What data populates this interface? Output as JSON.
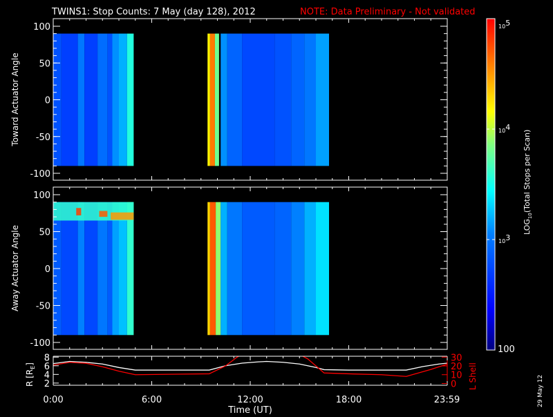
{
  "chart_data": [
    {
      "type": "heatmap",
      "title": "TWINS1: Stop Counts:  7 May (day 128), 2012",
      "note": "NOTE: Data Preliminary - Not validated",
      "ylabel": "Toward Actuator Angle",
      "ylim": [
        -100,
        100
      ],
      "yticks": [
        "100",
        "50",
        "0",
        "-50",
        "-100"
      ],
      "ytick_values": [
        100,
        50,
        0,
        -50,
        -100
      ],
      "xlim_hours": [
        0,
        24
      ],
      "angle_range": [
        -90,
        90
      ],
      "stripes": [
        [
          0,
          0.5,
          2.8
        ],
        [
          0.5,
          1.5,
          2.7
        ],
        [
          1.5,
          1.9,
          3.0
        ],
        [
          1.9,
          2.7,
          2.7
        ],
        [
          2.7,
          3.3,
          2.95
        ],
        [
          3.3,
          3.6,
          2.8
        ],
        [
          3.6,
          4.0,
          3.1
        ],
        [
          4.0,
          4.5,
          3.2
        ],
        [
          4.5,
          4.9,
          3.55
        ],
        [
          9.4,
          9.55,
          4.2
        ],
        [
          9.55,
          9.85,
          4.6
        ],
        [
          9.85,
          10.1,
          3.8
        ],
        [
          10.2,
          10.6,
          3.1
        ],
        [
          10.6,
          11.5,
          2.9
        ],
        [
          11.5,
          13.5,
          2.75
        ],
        [
          13.5,
          14.5,
          2.8
        ],
        [
          14.5,
          15.3,
          2.9
        ],
        [
          15.3,
          16.0,
          3.0
        ],
        [
          16.0,
          16.8,
          3.15
        ]
      ]
    },
    {
      "type": "heatmap",
      "ylabel": "Away Actuator Angle",
      "ylim": [
        -100,
        100
      ],
      "yticks": [
        "100",
        "50",
        "0",
        "-50",
        "-100"
      ],
      "ytick_values": [
        100,
        50,
        0,
        -50,
        -100
      ],
      "xlim_hours": [
        0,
        24
      ],
      "angle_range": [
        -90,
        90
      ],
      "stripes": [
        [
          0,
          0.5,
          2.85
        ],
        [
          0.5,
          1.5,
          2.75
        ],
        [
          1.5,
          1.9,
          3.05
        ],
        [
          1.9,
          2.7,
          2.75
        ],
        [
          2.7,
          3.3,
          3.0
        ],
        [
          3.3,
          3.6,
          2.85
        ],
        [
          3.6,
          4.0,
          3.15
        ],
        [
          4.0,
          4.5,
          3.25
        ],
        [
          4.5,
          4.9,
          3.6
        ],
        [
          9.4,
          9.55,
          4.3
        ],
        [
          9.55,
          9.9,
          4.7
        ],
        [
          9.9,
          10.2,
          3.9
        ],
        [
          10.2,
          10.6,
          3.2
        ],
        [
          10.6,
          11.5,
          3.0
        ],
        [
          11.5,
          13.5,
          2.85
        ],
        [
          13.5,
          14.5,
          2.9
        ],
        [
          14.5,
          15.3,
          3.05
        ],
        [
          15.3,
          16.0,
          3.2
        ],
        [
          16.0,
          16.8,
          3.35
        ]
      ],
      "patches": [
        [
          0,
          4.9,
          65,
          90,
          3.6
        ],
        [
          1.4,
          1.7,
          72,
          82,
          4.8
        ],
        [
          2.8,
          3.3,
          70,
          78,
          4.7
        ],
        [
          3.5,
          4.9,
          66,
          76,
          4.5
        ]
      ]
    },
    {
      "type": "line",
      "ylabel_left": "R [R",
      "ylabel_left_sub": "E",
      "ylabel_left_end": "]",
      "ylabel_right": "L Shell",
      "xlabel": "Time (UT)",
      "xticks": [
        "0:00",
        "6:00",
        "12:00",
        "18:00",
        "23:59"
      ],
      "xtick_hours": [
        0,
        6,
        12,
        18,
        23.98
      ],
      "yticks_left": [
        "8",
        "6",
        "4",
        "2"
      ],
      "ytick_left_values": [
        8,
        6,
        4,
        2
      ],
      "ylim_left": [
        1.5,
        8.2
      ],
      "yticks_right": [
        "30",
        "20",
        "10",
        "0"
      ],
      "ytick_right_values": [
        30,
        20,
        10,
        0
      ],
      "ylim_right": [
        -2,
        31
      ],
      "series": [
        {
          "name": "R",
          "color": "#ffffff",
          "axis": "left",
          "x": [
            0,
            1,
            2,
            3,
            4,
            5,
            9.5,
            10.5,
            11.5,
            12.5,
            13,
            14,
            15,
            16,
            16.5,
            18,
            21.5,
            22.5,
            23.5,
            24
          ],
          "y": [
            6.5,
            7.0,
            6.8,
            6.4,
            5.6,
            5.0,
            5.0,
            6.0,
            6.6,
            6.9,
            7.0,
            6.8,
            6.4,
            5.6,
            5.1,
            5.0,
            5.0,
            5.8,
            6.4,
            6.6
          ]
        },
        {
          "name": "L Shell",
          "color": "#ff0000",
          "axis": "right",
          "x": [
            0,
            1,
            2,
            3,
            4,
            5,
            7,
            9.5,
            10.5,
            11.2,
            11.5,
            15,
            15.5,
            16.5,
            18,
            20,
            21.5,
            23,
            24
          ],
          "y": [
            21,
            24,
            23,
            19,
            14,
            10,
            10.5,
            11,
            20,
            30,
            33,
            33,
            28,
            12,
            11,
            10,
            8,
            16,
            22
          ]
        }
      ]
    }
  ],
  "colorbar": {
    "label_main": "LOG",
    "label_sub": "10",
    "label_rest": "(Total Stops per Scan)",
    "ticks": [
      {
        "base": "10",
        "exp": "5",
        "value": 5
      },
      {
        "base": "10",
        "exp": "4",
        "value": 4
      },
      {
        "base": "10",
        "exp": "3",
        "value": 3
      }
    ],
    "bottom_label": "100",
    "range_log": [
      2,
      5
    ]
  },
  "date_stamp": "29 May 12",
  "colors": {
    "note": "#ff0000",
    "lshell": "#ff0000",
    "axes": "#ffffff"
  }
}
